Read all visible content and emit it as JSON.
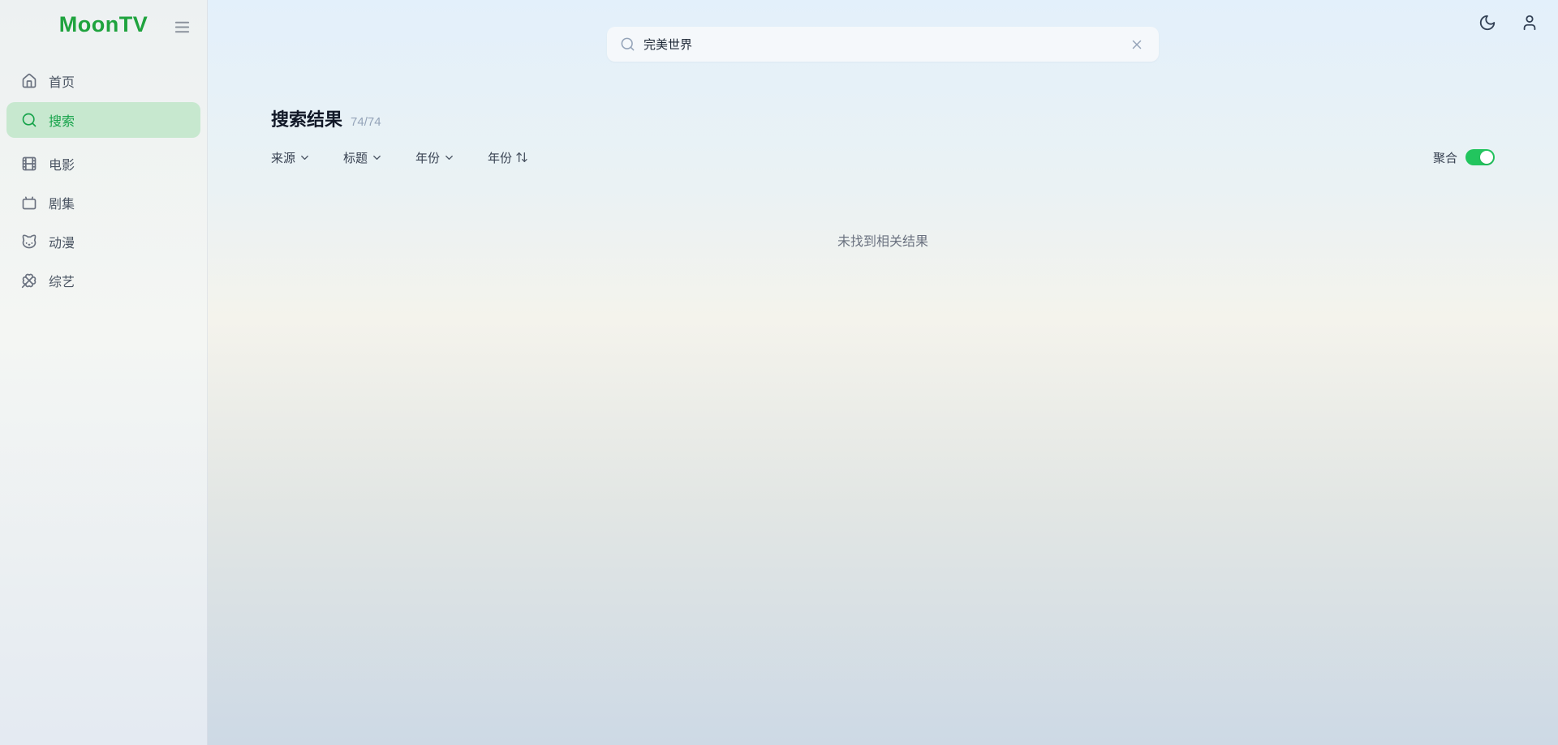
{
  "app": {
    "name": "MoonTV"
  },
  "colors": {
    "brand_green": "#1fa33e",
    "active_item_bg": "#c7e8cf",
    "active_item_text": "#16a34a",
    "toggle_on": "#22c55e"
  },
  "sidebar": {
    "logo": "MoonTV",
    "menu_icon": "hamburger-menu-icon",
    "items": [
      {
        "label": "首页",
        "icon": "home-icon",
        "active": false
      },
      {
        "label": "搜索",
        "icon": "search-icon",
        "active": true
      },
      {
        "label": "电影",
        "icon": "film-icon",
        "active": false
      },
      {
        "label": "剧集",
        "icon": "tv-icon",
        "active": false
      },
      {
        "label": "动漫",
        "icon": "cat-icon",
        "active": false
      },
      {
        "label": "综艺",
        "icon": "clover-icon",
        "active": false
      }
    ]
  },
  "header": {
    "search": {
      "value": "完美世界",
      "placeholder": "",
      "icons": [
        "search-icon",
        "clear-x-icon"
      ]
    },
    "actions": [
      "moon-theme-icon",
      "user-icon"
    ]
  },
  "main": {
    "title": "搜索结果",
    "count": "74/74",
    "filters": [
      {
        "label": "来源",
        "control": "dropdown",
        "icon": "chevron-down-icon"
      },
      {
        "label": "标题",
        "control": "dropdown",
        "icon": "chevron-down-icon"
      },
      {
        "label": "年份",
        "control": "dropdown",
        "icon": "chevron-down-icon"
      },
      {
        "label": "年份",
        "control": "sort",
        "icon": "arrow-up-down-icon"
      }
    ],
    "aggregate": {
      "label": "聚合",
      "enabled": true
    },
    "empty_message": "未找到相关结果"
  }
}
